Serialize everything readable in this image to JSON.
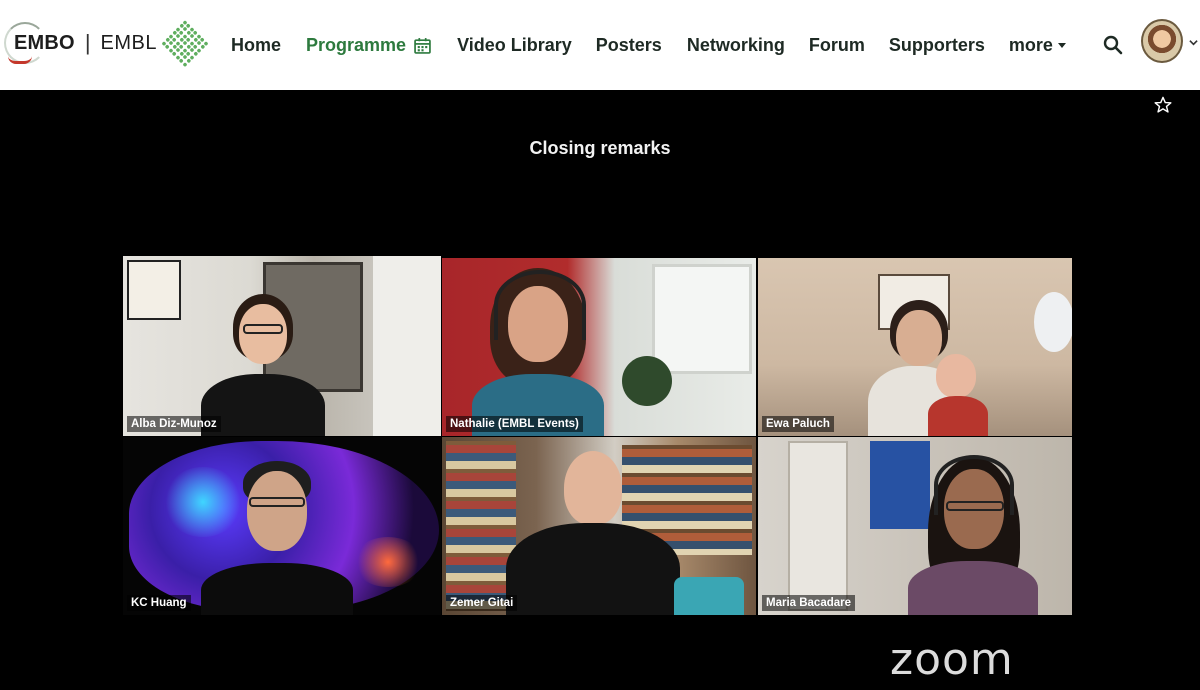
{
  "brand": {
    "embo": "EMBO",
    "separator": "|",
    "embl": "EMBL"
  },
  "nav": {
    "home": "Home",
    "programme": "Programme",
    "video_library": "Video Library",
    "posters": "Posters",
    "networking": "Networking",
    "forum": "Forum",
    "supporters": "Supporters",
    "more": "more"
  },
  "icons": {
    "programme": "calendar-icon",
    "more": "caret-down-icon",
    "search": "search-icon",
    "account": "avatar",
    "account_menu": "chevron-down-icon",
    "favorite": "star-icon"
  },
  "session": {
    "title": "Closing remarks"
  },
  "participants": [
    {
      "name": "Alba Diz-Munoz",
      "speaking": true
    },
    {
      "name": "Nathalie (EMBL Events)",
      "speaking": false
    },
    {
      "name": "Ewa Paluch",
      "speaking": false
    },
    {
      "name": "KC Huang",
      "speaking": false
    },
    {
      "name": "Zemer Gitai",
      "speaking": false
    },
    {
      "name": "Maria Bacadare",
      "speaking": false
    }
  ],
  "footer": {
    "zoom": "zoom"
  },
  "colors": {
    "active_nav": "#2d7a3e",
    "speaker_highlight": "#a6d24f",
    "brand_green": "#5fae5f",
    "brand_red": "#c4372b"
  }
}
